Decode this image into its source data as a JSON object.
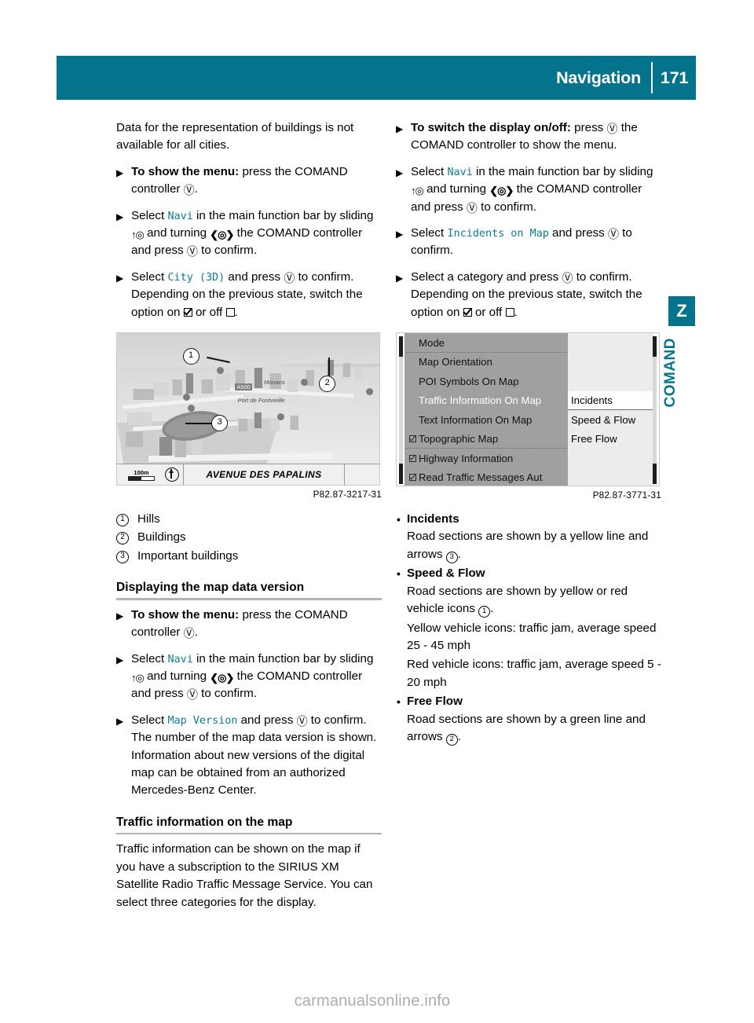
{
  "header": {
    "title": "Navigation",
    "page_number": "171",
    "accent_color": "#04748c"
  },
  "edge_tab": {
    "letter": "Z",
    "label": "COMAND"
  },
  "glyphs": {
    "press": "Ⓤ",
    "slide": "↑◎",
    "turn": "❮◎❯"
  },
  "left_column": {
    "intro": "Data for the representation of buildings is not available for all cities.",
    "steps": [
      {
        "bold": "To show the menu:",
        "rest": " press the COMAND controller ",
        "glyph": "press",
        "tail": "."
      }
    ],
    "step_navi": {
      "pre": "Select ",
      "mono": "Navi",
      "mid1": " in the main function bar by sliding ",
      "mid2": " and turning ",
      "mid3": " the COMAND controller and press ",
      "tail": " to confirm."
    },
    "step_city3d": {
      "pre": "Select ",
      "mono": "City (3D)",
      "mid": " and press ",
      "tail": " to confirm.",
      "note_a": "Depending on the previous state, switch the option on ",
      "note_on": " or off ",
      "note_b": "."
    },
    "figure_map": {
      "caption": "P82.87-3217-31",
      "street_name": "AVENUE DES PAPALINS",
      "scale": "100m",
      "place_labels": [
        "Monaco",
        "Port de Fontvieille",
        "A500"
      ],
      "callouts": [
        "1",
        "2",
        "3"
      ]
    },
    "legend": [
      {
        "num": "1",
        "label": "Hills"
      },
      {
        "num": "2",
        "label": "Buildings"
      },
      {
        "num": "3",
        "label": "Important buildings"
      }
    ],
    "section_map_version": {
      "heading": "Displaying the map data version",
      "step_menu": {
        "bold": "To show the menu:",
        "rest": " press the COMAND controller ",
        "tail": "."
      },
      "step_navi": {
        "pre": "Select ",
        "mono": "Navi",
        "mid1": " in the main function bar by sliding ",
        "mid2": " and turning ",
        "mid3": " the COMAND controller and press ",
        "tail": " to confirm."
      },
      "step_mapversion": {
        "pre": "Select ",
        "mono": "Map Version",
        "mid": " and press ",
        "tail": " to confirm.",
        "note": "The number of the map data version is shown. Information about new versions of the digital map can be obtained from an authorized Mercedes-Benz Center."
      }
    },
    "section_traffic": {
      "heading": "Traffic information on the map",
      "body": "Traffic information can be shown on the map if you have a subscription to the SIRIUS XM Satellite Radio Traffic Message Service. You can select three categories for the display."
    }
  },
  "right_column": {
    "step_toggle": {
      "bold": "To switch the display on/off:",
      "rest": " press ",
      "tail": " the COMAND controller to show the menu."
    },
    "step_navi": {
      "pre": "Select ",
      "mono": "Navi",
      "mid1": " in the main function bar by sliding ",
      "mid2": " and turning ",
      "mid3": " the COMAND controller and press ",
      "tail": " to confirm."
    },
    "step_incidents": {
      "pre": "Select ",
      "mono": "Incidents on Map",
      "mid": " and press ",
      "tail": " to confirm."
    },
    "step_category": {
      "text_a": "Select a category and press ",
      "text_b": " to confirm.",
      "note_a": "Depending on the previous state, switch the option on ",
      "note_on": " or off ",
      "note_b": "."
    },
    "figure_menu": {
      "caption": "P82.87-3771-31",
      "main_items": [
        {
          "label": "Mode",
          "checkbox": "none",
          "selected": false,
          "divider_below": true
        },
        {
          "label": "Map Orientation",
          "checkbox": "none",
          "selected": false,
          "divider_below": false
        },
        {
          "label": "POI Symbols On Map",
          "checkbox": "none",
          "selected": false,
          "divider_below": false
        },
        {
          "label": "Traffic Information On Map",
          "checkbox": "none",
          "selected": true,
          "divider_below": false
        },
        {
          "label": "Text Information On Map",
          "checkbox": "none",
          "selected": false,
          "divider_below": false
        },
        {
          "label": "Topographic Map",
          "checkbox": "checked",
          "selected": false,
          "divider_below": true
        },
        {
          "label": "Highway Information",
          "checkbox": "checked",
          "selected": false,
          "divider_below": false
        },
        {
          "label": "Read Traffic Messages Aut",
          "checkbox": "checked",
          "selected": false,
          "divider_below": false
        }
      ],
      "sub_items": [
        {
          "label": "Incidents",
          "checkbox": "checked",
          "highlighted": true
        },
        {
          "label": "Speed & Flow",
          "checkbox": "checked",
          "highlighted": false
        },
        {
          "label": "Free Flow",
          "checkbox": "unchecked",
          "highlighted": false
        }
      ]
    },
    "categories": [
      {
        "title": "Incidents",
        "lines": [
          {
            "a": "Road sections are shown by a yellow line and arrows ",
            "num": "3",
            "b": "."
          }
        ]
      },
      {
        "title": "Speed & Flow",
        "lines": [
          {
            "a": "Road sections are shown by yellow or red vehicle icons ",
            "num": "1",
            "b": "."
          },
          {
            "a": "Yellow vehicle icons: traffic jam, average speed 25 - 45 mph",
            "num": "",
            "b": ""
          },
          {
            "a": "Red vehicle icons: traffic jam, average speed 5 - 20 mph",
            "num": "",
            "b": ""
          }
        ]
      },
      {
        "title": "Free Flow",
        "lines": [
          {
            "a": "Road sections are shown by a green line and arrows ",
            "num": "2",
            "b": "."
          }
        ]
      }
    ]
  },
  "watermark": "carmanualsonline.info"
}
